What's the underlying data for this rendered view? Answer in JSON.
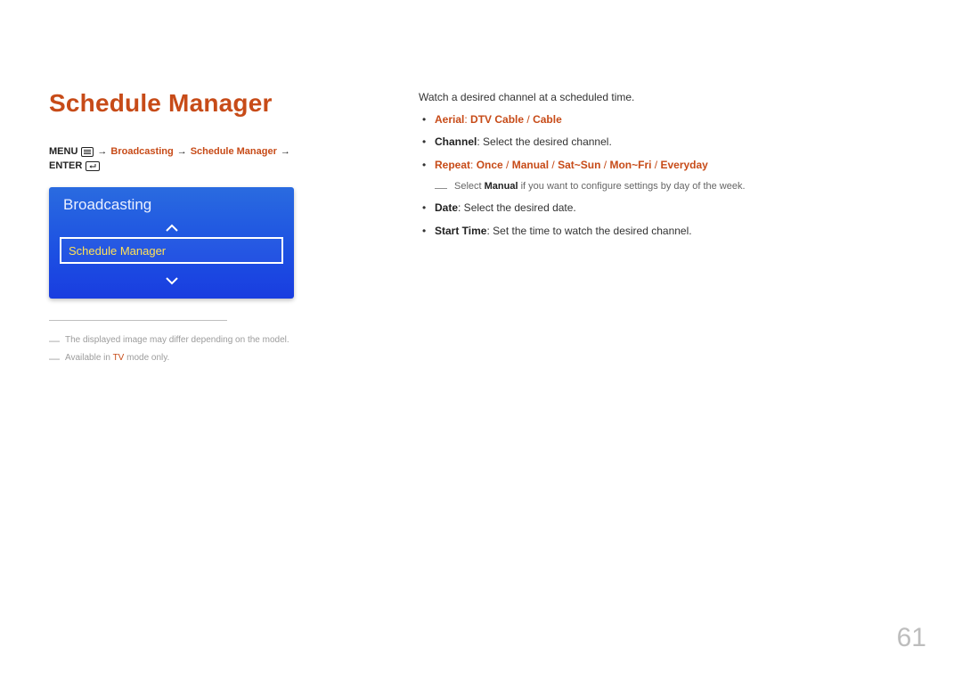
{
  "title": "Schedule Manager",
  "nav": {
    "menu": "MENU",
    "path1": "Broadcasting",
    "path2": "Schedule Manager",
    "enter": "ENTER"
  },
  "tvmenu": {
    "title": "Broadcasting",
    "selected": "Schedule Manager"
  },
  "footnotes": {
    "f1": "The displayed image may differ depending on the model.",
    "f2a": "Available in ",
    "f2b": "TV",
    "f2c": " mode only."
  },
  "r": {
    "intro": "Watch a desired channel at a scheduled time.",
    "aerial_label": "Aerial",
    "aerial_v1": "DTV Cable",
    "aerial_v2": "Cable",
    "channel_label": "Channel",
    "channel_text": ": Select the desired channel.",
    "repeat_label": "Repeat",
    "repeat_v1": "Once",
    "repeat_v2": "Manual",
    "repeat_v3": "Sat~Sun",
    "repeat_v4": "Mon~Fri",
    "repeat_v5": "Everyday",
    "repeat_note_a": "Select ",
    "repeat_note_b": "Manual",
    "repeat_note_c": " if you want to configure settings by day of the week.",
    "date_label": "Date",
    "date_text": ": Select the desired date.",
    "start_label": "Start Time",
    "start_text": ": Set the time to watch the desired channel."
  },
  "page_number": "61",
  "arrow": "→",
  "colon_sep": ": ",
  "slash": " / "
}
